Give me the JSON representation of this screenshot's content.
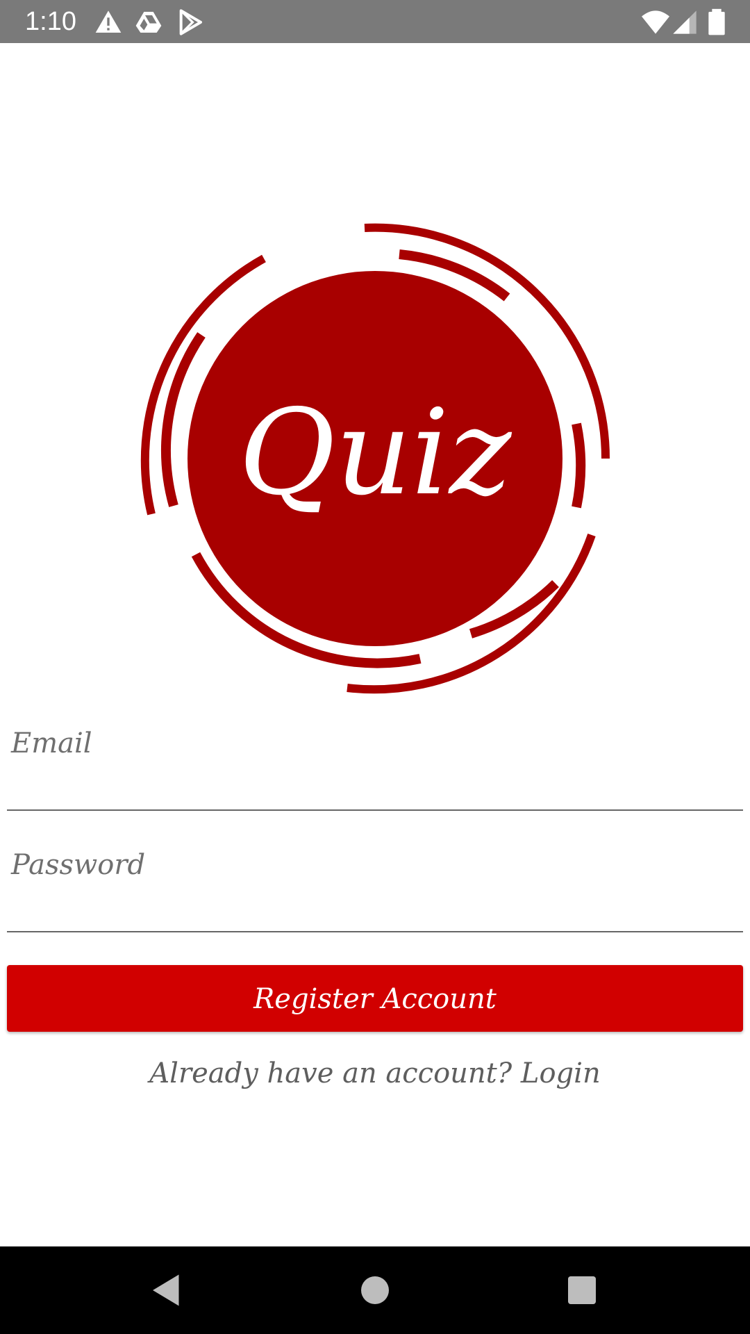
{
  "status_bar": {
    "time": "1:10",
    "icons_left": [
      "warning-icon",
      "drive-icon",
      "play-store-icon"
    ],
    "icons_right": [
      "wifi-icon",
      "signal-icon",
      "battery-icon"
    ],
    "background": "#7a7a7a"
  },
  "logo": {
    "text": "Quiz",
    "color": "#a80000"
  },
  "form": {
    "email": {
      "label": "Email",
      "value": ""
    },
    "password": {
      "label": "Password",
      "value": ""
    },
    "register_button_label": "Register Account",
    "login_link": "Already have an account? Login"
  },
  "colors": {
    "accent": "#d10000",
    "logo": "#a80000",
    "hint_text": "#6f6f6f"
  },
  "nav_bar": {
    "icons": [
      "back-icon",
      "home-icon",
      "recents-icon"
    ]
  }
}
